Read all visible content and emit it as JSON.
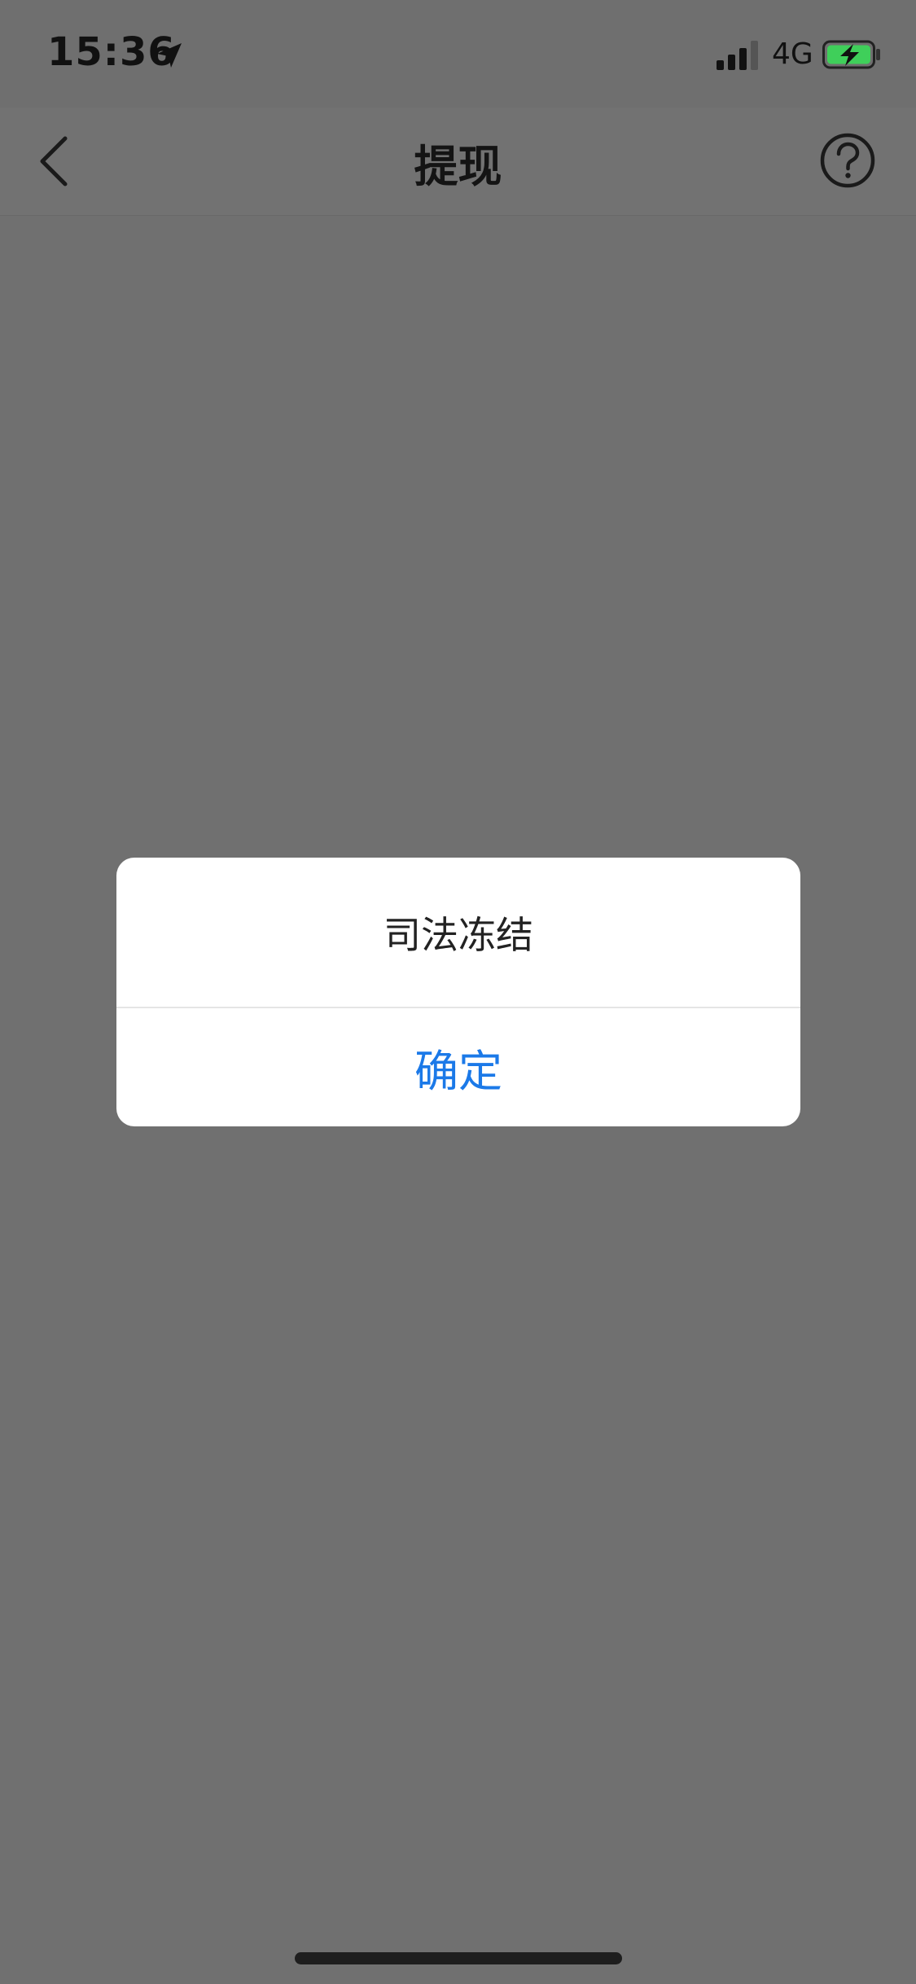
{
  "status_bar": {
    "time": "15:36",
    "network": "4G",
    "icons": [
      "location-arrow-icon",
      "signal-bars-icon",
      "battery-charging-icon"
    ]
  },
  "nav": {
    "title": "提现",
    "icons": [
      "back-chevron-icon",
      "help-question-icon"
    ]
  },
  "dialog": {
    "message": "司法冻结",
    "confirm_label": "确定"
  },
  "colors": {
    "overlay": "#707070",
    "dialog_bg": "#ffffff",
    "accent": "#1b79e8",
    "battery_green": "#3fcf5a"
  }
}
